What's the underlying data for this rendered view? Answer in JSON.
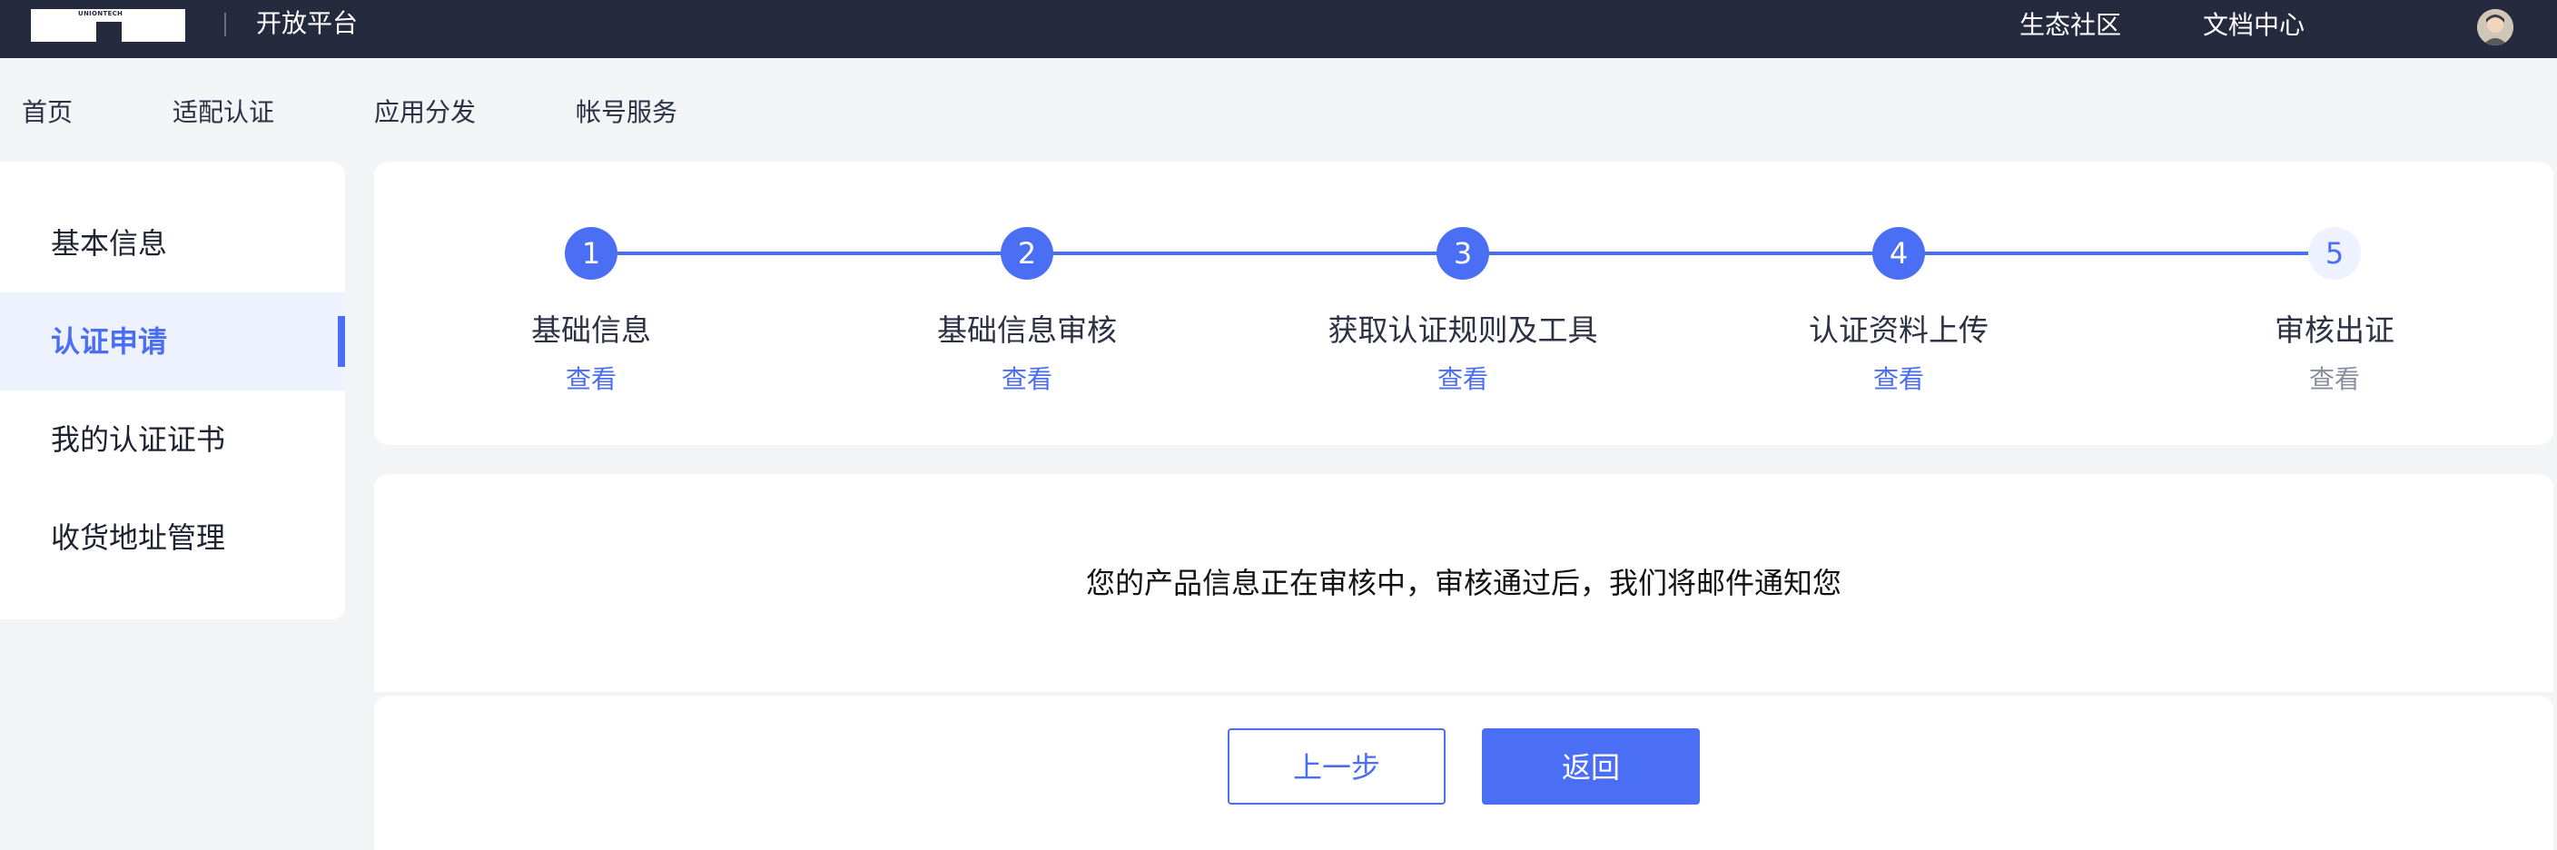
{
  "topbar": {
    "logo_text": "UNIONTECH",
    "platform_title": "开放平台",
    "links": [
      "生态社区",
      "文档中心"
    ]
  },
  "main_nav": [
    "首页",
    "适配认证",
    "应用分发",
    "帐号服务"
  ],
  "sidebar": {
    "items": [
      {
        "label": "基本信息",
        "active": false
      },
      {
        "label": "认证申请",
        "active": true
      },
      {
        "label": "我的认证证书",
        "active": false
      },
      {
        "label": "收货地址管理",
        "active": false
      }
    ]
  },
  "steps": [
    {
      "number": "1",
      "title": "基础信息",
      "link": "查看",
      "status": "done"
    },
    {
      "number": "2",
      "title": "基础信息审核",
      "link": "查看",
      "status": "done"
    },
    {
      "number": "3",
      "title": "获取认证规则及工具",
      "link": "查看",
      "status": "done"
    },
    {
      "number": "4",
      "title": "认证资料上传",
      "link": "查看",
      "status": "done"
    },
    {
      "number": "5",
      "title": "审核出证",
      "link": "查看",
      "status": "pending"
    }
  ],
  "message": "您的产品信息正在审核中，审核通过后，我们将邮件通知您",
  "buttons": {
    "prev": "上一步",
    "back": "返回"
  },
  "colors": {
    "topbar": "#252a3f",
    "accent": "#4a6ef4",
    "active_bg": "#eef1fe",
    "page_bg": "#f3f4f6"
  }
}
